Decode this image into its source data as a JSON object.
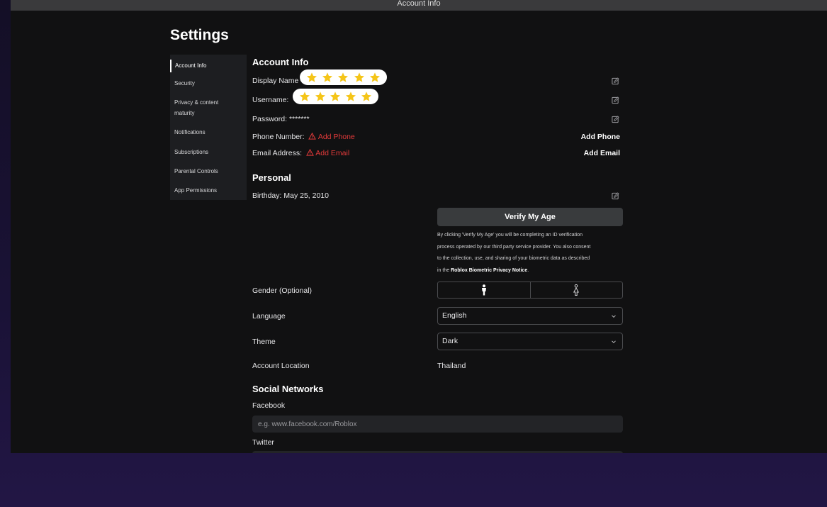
{
  "window": {
    "title": "Account Info"
  },
  "page": {
    "title": "Settings"
  },
  "sidebar": {
    "items": [
      {
        "label": "Account Info",
        "active": true
      },
      {
        "label": "Security"
      },
      {
        "label": "Privacy & content"
      },
      {
        "label": "maturity"
      },
      {
        "label": "Notifications"
      },
      {
        "label": "Subscriptions"
      },
      {
        "label": "Parental Controls"
      },
      {
        "label": "App Permissions"
      }
    ]
  },
  "account": {
    "heading": "Account Info",
    "display_name_label": "Display Name",
    "username_label": "Username:",
    "password_label": "Password:",
    "password_value": "*******",
    "phone_label": "Phone Number:",
    "phone_link": "Add Phone",
    "phone_action": "Add Phone",
    "email_label": "Email Address:",
    "email_link": "Add Email",
    "email_action": "Add Email"
  },
  "personal": {
    "heading": "Personal",
    "birthday_label": "Birthday:",
    "birthday_value": "May 25, 2010",
    "verify_button": "Verify My Age",
    "consent_line1": "By clicking 'Verify My Age' you will be completing an ID verification",
    "consent_line2": "process operated by our third party service provider. You also consent",
    "consent_line3": "to the collection, use, and sharing of your biometric data as described",
    "consent_line4_prefix": "in the",
    "consent_link": "Roblox Biometric Privacy Notice",
    "consent_line4_suffix": ".",
    "gender_label": "Gender (Optional)",
    "language_label": "Language",
    "language_value": "English",
    "theme_label": "Theme",
    "theme_value": "Dark",
    "location_label": "Account Location",
    "location_value": "Thailand"
  },
  "social": {
    "heading": "Social Networks",
    "facebook_label": "Facebook",
    "facebook_placeholder": "e.g. www.facebook.com/Roblox",
    "twitter_label": "Twitter"
  },
  "colors": {
    "background": "#111112",
    "sidebar": "#1d1e21",
    "warning_red": "#e23a3a",
    "star_yellow": "#f5c518"
  },
  "icons": {
    "edit": "edit-pencil-square-icon",
    "warning": "warning-triangle-icon",
    "male": "male-icon",
    "female": "female-icon",
    "chevron": "chevron-down-icon",
    "star": "star-icon"
  }
}
